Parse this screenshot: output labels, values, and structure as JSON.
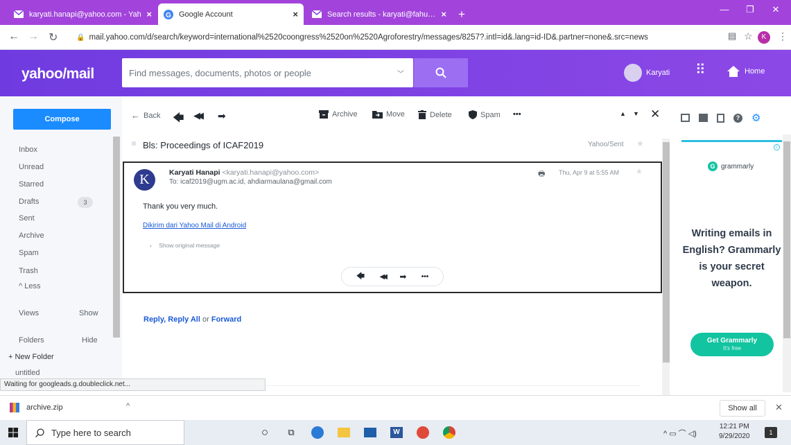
{
  "browser": {
    "tabs": [
      {
        "title": "karyati.hanapi@yahoo.com - Yah",
        "active": false
      },
      {
        "title": "Google Account",
        "active": true
      },
      {
        "title": "Search results - karyati@fahutan.",
        "active": false
      }
    ],
    "new_tab": "+",
    "url": "mail.yahoo.com/d/search/keyword=international%2520coongress%2520on%2520Agroforestry/messages/8257?.intl=id&.lang=id-ID&.partner=none&.src=news",
    "profile_initial": "K"
  },
  "yahoo": {
    "logo": "yahoo/mail",
    "search_placeholder": "Find messages, documents, photos or people",
    "user_name": "Karyati",
    "home_label": "Home"
  },
  "sidebar": {
    "compose_label": "Compose",
    "items": [
      {
        "label": "Inbox"
      },
      {
        "label": "Unread"
      },
      {
        "label": "Starred"
      },
      {
        "label": "Drafts",
        "count": "3"
      },
      {
        "label": "Sent"
      },
      {
        "label": "Archive"
      },
      {
        "label": "Spam"
      },
      {
        "label": "Trash"
      },
      {
        "label": "^ Less"
      }
    ],
    "views_label": "Views",
    "views_action": "Show",
    "folders_label": "Folders",
    "folders_action": "Hide",
    "new_folder": "+ New Folder",
    "untitled": "untitled"
  },
  "toolbar": {
    "back": "Back",
    "archive": "Archive",
    "move": "Move",
    "delete": "Delete",
    "spam": "Spam",
    "more": "•••"
  },
  "message": {
    "subject": "Bls: Proceedings of ICAF2019",
    "folder": "Yahoo/Sent",
    "sender_name": "Karyati Hanapi",
    "sender_email": "<karyati.hanapi@yahoo.com>",
    "avatar_letter": "K",
    "to_label": "To:",
    "to_recipients": "icaf2019@ugm.ac.id,  ahdiarmaulana@gmail.com",
    "date": "Thu, Apr 9 at 5:55 AM",
    "body": "Thank you very much.",
    "signature_link": "Dikirim dari Yahoo Mail di Android",
    "show_original": "Show original message",
    "more": "•••"
  },
  "reply_links": {
    "reply": "Reply",
    "sep1": ", ",
    "reply_all": "Reply All",
    "or": " or ",
    "forward": "Forward"
  },
  "ad": {
    "brand": "grammarly",
    "headline": "Writing emails in English? Grammarly is your secret weapon.",
    "cta": "Get Grammarly",
    "cta_sub": "It's free"
  },
  "status_bar": "Waiting for googleads.g.doubleclick.net...",
  "downloads": {
    "file": "archive.zip",
    "show_all": "Show all"
  },
  "taskbar": {
    "search_placeholder": "Type here to search",
    "time": "12:21 PM",
    "date": "9/29/2020",
    "notifications": "1"
  },
  "colors": {
    "yahoo_purple": "#7c3ee0",
    "chrome_tabstrip": "#a244db",
    "compose_blue": "#1a8cff",
    "grammarly_green": "#12c4a0"
  }
}
